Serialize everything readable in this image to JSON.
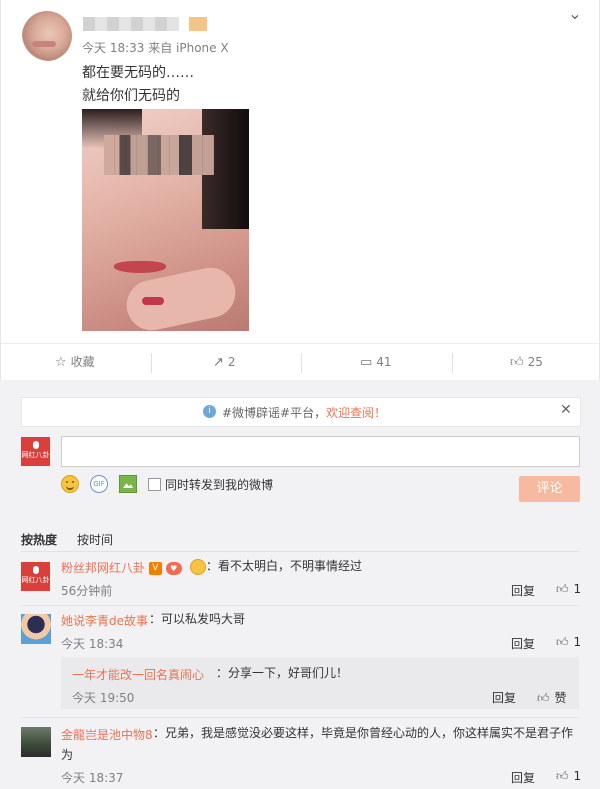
{
  "post": {
    "meta": "今天 18:33 来自 iPhone X",
    "line1": "都在要无码的……",
    "line2": "就给你们无码的",
    "image_icon": "portrait-photo"
  },
  "actions": {
    "favorite": {
      "icon": "star-outline-icon",
      "label": "收藏"
    },
    "repost": {
      "icon": "share-icon",
      "label": "2"
    },
    "comment": {
      "icon": "comment-icon",
      "label": "41"
    },
    "like": {
      "icon": "thumb-up-icon",
      "label": "25"
    }
  },
  "notice": {
    "prefix": "#微博辟谣#平台，",
    "link": "欢迎查阅！"
  },
  "composer": {
    "input_value": "",
    "checkbox_label": "同时转发到我的微博",
    "submit_label": "评论"
  },
  "sort_tabs": {
    "hot": "按热度",
    "time": "按时间"
  },
  "comments": [
    {
      "name": "粉丝邦网红八卦",
      "text": "：看不太明白，不明事情经过",
      "time": "56分钟前",
      "reply": "回复",
      "likes": "1"
    },
    {
      "name": "她说李青de故事",
      "text": "：可以私发吗大哥",
      "time": "今天 18:34",
      "reply": "回复",
      "likes": "1"
    },
    {
      "name": "金龍岂是池中物8",
      "text": "：兄弟，我是感觉没必要这样，毕竟是你曾经心动的人，你这样属实不是君子作为",
      "time": "今天 18:37",
      "reply": "回复",
      "likes": "1"
    }
  ],
  "subreply": {
    "name": "一年才能改一回名真闹心",
    "text": "：分享一下，好哥们儿！",
    "time": "今天 19:50",
    "reply": "回复",
    "likes": "赞"
  },
  "brand_logo_text": "网红八卦",
  "colors": {
    "link": "#eb7350",
    "submit_disabled": "#f7b9a0",
    "logo_red": "#d9403a"
  }
}
